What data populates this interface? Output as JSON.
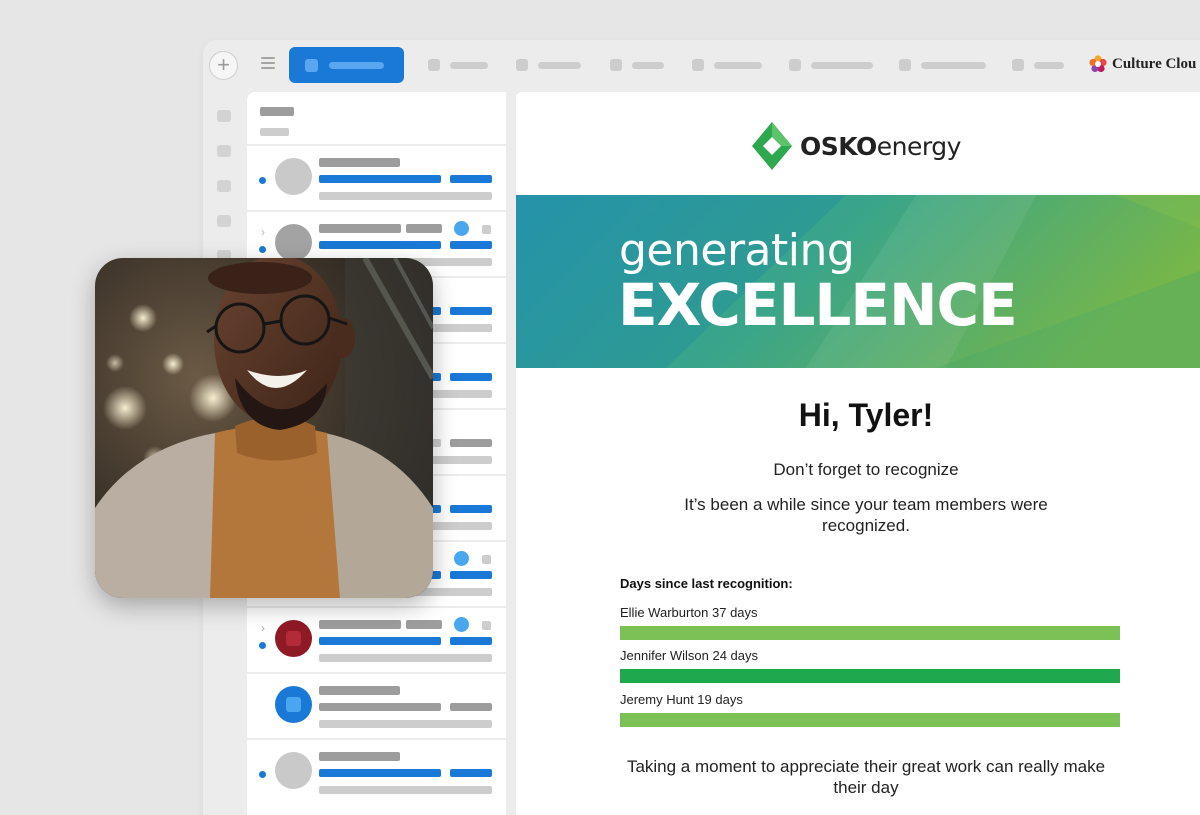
{
  "toolbar": {
    "new_button": "+",
    "brand_name": "Culture Clou"
  },
  "email": {
    "logo": {
      "bold": "OSKO",
      "light": "energy"
    },
    "hero": {
      "line1": "generating",
      "line2": "EXCELLENCE"
    },
    "greeting": "Hi, Tyler!",
    "subtitle": "Don’t forget to recognize",
    "message": "It’s been a while since your team members were recognized.",
    "days_title": "Days since last recognition:",
    "members": [
      {
        "label": "Ellie Warburton 37 days",
        "days": 37,
        "color": "#7cc155"
      },
      {
        "label": "Jennifer Wilson 24 days",
        "days": 24,
        "color": "#1fa94c"
      },
      {
        "label": "Jeremy Hunt 19 days",
        "days": 19,
        "color": "#7cc155"
      }
    ],
    "closing": "Taking a moment to appreciate their great work can really make their day"
  },
  "colors": {
    "accent": "#1a78d6",
    "brand_green": "#2ea84f",
    "hero_teal": "#2a98b0",
    "hero_green": "#76b64a"
  }
}
